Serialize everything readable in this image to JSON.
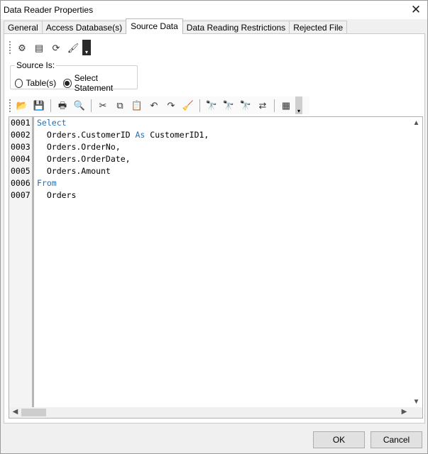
{
  "window": {
    "title": "Data Reader Properties"
  },
  "tabs": [
    "General",
    "Access Database(s)",
    "Source Data",
    "Data Reading Restrictions",
    "Rejected File"
  ],
  "source": {
    "legend": "Source Is:",
    "options": [
      "Table(s)",
      "Select Statement"
    ],
    "selected": "Select Statement"
  },
  "editor": {
    "lines": [
      {
        "num": "0001",
        "kw": "Select",
        "text": ""
      },
      {
        "num": "0002",
        "pre": "  Orders.CustomerID ",
        "kw": "As",
        "text": " CustomerID1,"
      },
      {
        "num": "0003",
        "text": "  Orders.OrderNo,"
      },
      {
        "num": "0004",
        "text": "  Orders.OrderDate,"
      },
      {
        "num": "0005",
        "text": "  Orders.Amount"
      },
      {
        "num": "0006",
        "kw": "From",
        "text": ""
      },
      {
        "num": "0007",
        "text": "  Orders"
      }
    ]
  },
  "buttons": {
    "ok": "OK",
    "cancel": "Cancel"
  }
}
